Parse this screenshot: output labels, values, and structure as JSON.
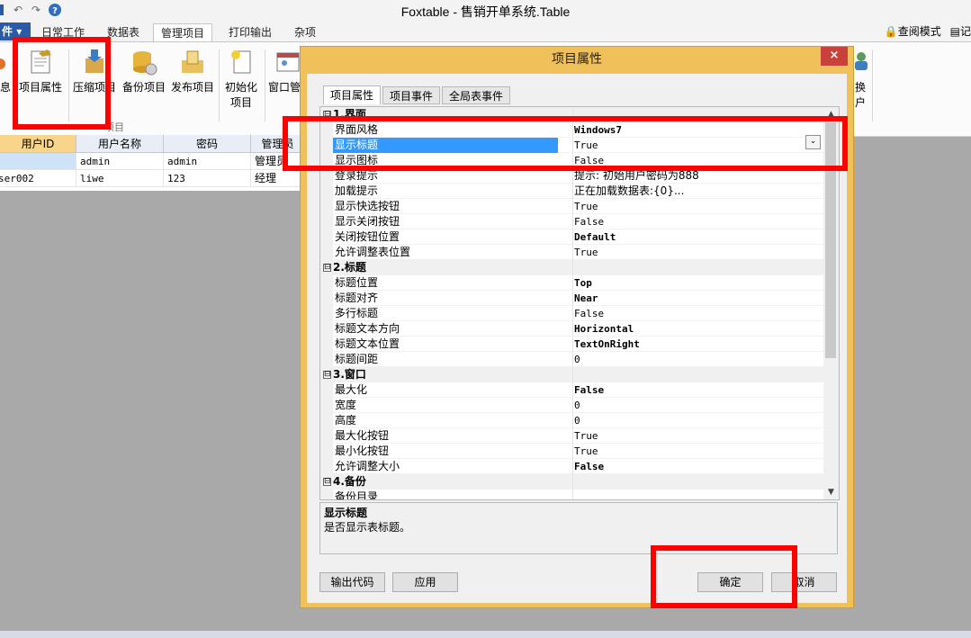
{
  "window": {
    "title": "Foxtable - 售销开单系统.Table"
  },
  "ribbon_tabs": {
    "file": "件",
    "tabs": [
      "日常工作",
      "数据表",
      "管理项目",
      "打印输出",
      "杂项"
    ],
    "active": "管理项目",
    "right_tools": {
      "query_mode": "查阅模式",
      "record": "记"
    }
  },
  "ribbon_buttons": {
    "info": "息",
    "project_props": "项目属性",
    "compress": "压缩项目",
    "backup": "备份项目",
    "publish": "发布项目",
    "init_line1": "初始化",
    "init_line2": "项目",
    "window_mgr": "窗口管",
    "switch_line1": "换",
    "switch_line2": "户",
    "group_label": "项目"
  },
  "grid": {
    "columns": [
      "用户ID",
      "用户名称",
      "密码",
      "管理员"
    ],
    "rows": [
      [
        "",
        "admin",
        "admin",
        "管理员"
      ],
      [
        "ser002",
        "liwe",
        "123",
        "经理"
      ]
    ]
  },
  "dialog": {
    "title": "项目属性",
    "close": "×",
    "tabs": [
      "项目属性",
      "项目事件",
      "全局表事件"
    ],
    "active_tab": "项目属性",
    "property_grid": [
      {
        "type": "category",
        "toggle": "⊟",
        "label": "1.界面"
      },
      {
        "type": "item",
        "name": "界面风格",
        "value": "Windows7",
        "bold": true
      },
      {
        "type": "item",
        "name": "显示标题",
        "value": "True",
        "selected": true
      },
      {
        "type": "item",
        "name": "显示图标",
        "value": "False"
      },
      {
        "type": "item",
        "name": "登录提示",
        "value": "提示: 初始用户密码为888",
        "cn": true
      },
      {
        "type": "item",
        "name": "加载提示",
        "value": "正在加载数据表:{0}...",
        "cn": true
      },
      {
        "type": "item",
        "name": "显示快选按钮",
        "value": "True"
      },
      {
        "type": "item",
        "name": "显示关闭按钮",
        "value": "False"
      },
      {
        "type": "item",
        "name": "关闭按钮位置",
        "value": "Default",
        "bold": true
      },
      {
        "type": "item",
        "name": "允许调整表位置",
        "value": "True"
      },
      {
        "type": "category",
        "toggle": "⊟",
        "label": "2.标题"
      },
      {
        "type": "item",
        "name": "标题位置",
        "value": "Top",
        "bold": true
      },
      {
        "type": "item",
        "name": "标题对齐",
        "value": "Near",
        "bold": true
      },
      {
        "type": "item",
        "name": "多行标题",
        "value": "False"
      },
      {
        "type": "item",
        "name": "标题文本方向",
        "value": "Horizontal",
        "bold": true
      },
      {
        "type": "item",
        "name": "标题文本位置",
        "value": "TextOnRight",
        "bold": true
      },
      {
        "type": "item",
        "name": "标题间距",
        "value": "0"
      },
      {
        "type": "category",
        "toggle": "⊟",
        "label": "3.窗口"
      },
      {
        "type": "item",
        "name": "最大化",
        "value": "False",
        "bold": true
      },
      {
        "type": "item",
        "name": "宽度",
        "value": "0"
      },
      {
        "type": "item",
        "name": "高度",
        "value": "0"
      },
      {
        "type": "item",
        "name": "最大化按钮",
        "value": "True"
      },
      {
        "type": "item",
        "name": "最小化按钮",
        "value": "True"
      },
      {
        "type": "item",
        "name": "允许调整大小",
        "value": "False",
        "bold": true
      },
      {
        "type": "category",
        "toggle": "⊟",
        "label": "4.备份"
      },
      {
        "type": "item",
        "name": "备份目录",
        "value": ""
      }
    ],
    "dropdown_glyph": "⌄",
    "description": {
      "title": "显示标题",
      "text": "是否显示表标题。"
    },
    "buttons": {
      "export_code": "输出代码",
      "apply": "应用",
      "ok": "确定",
      "cancel": "取消"
    }
  },
  "colors": {
    "selection": "#3399ff",
    "dialog_frame": "#f0c05a",
    "highlight": "#ff0000",
    "file_tab": "#2a5aa8"
  }
}
